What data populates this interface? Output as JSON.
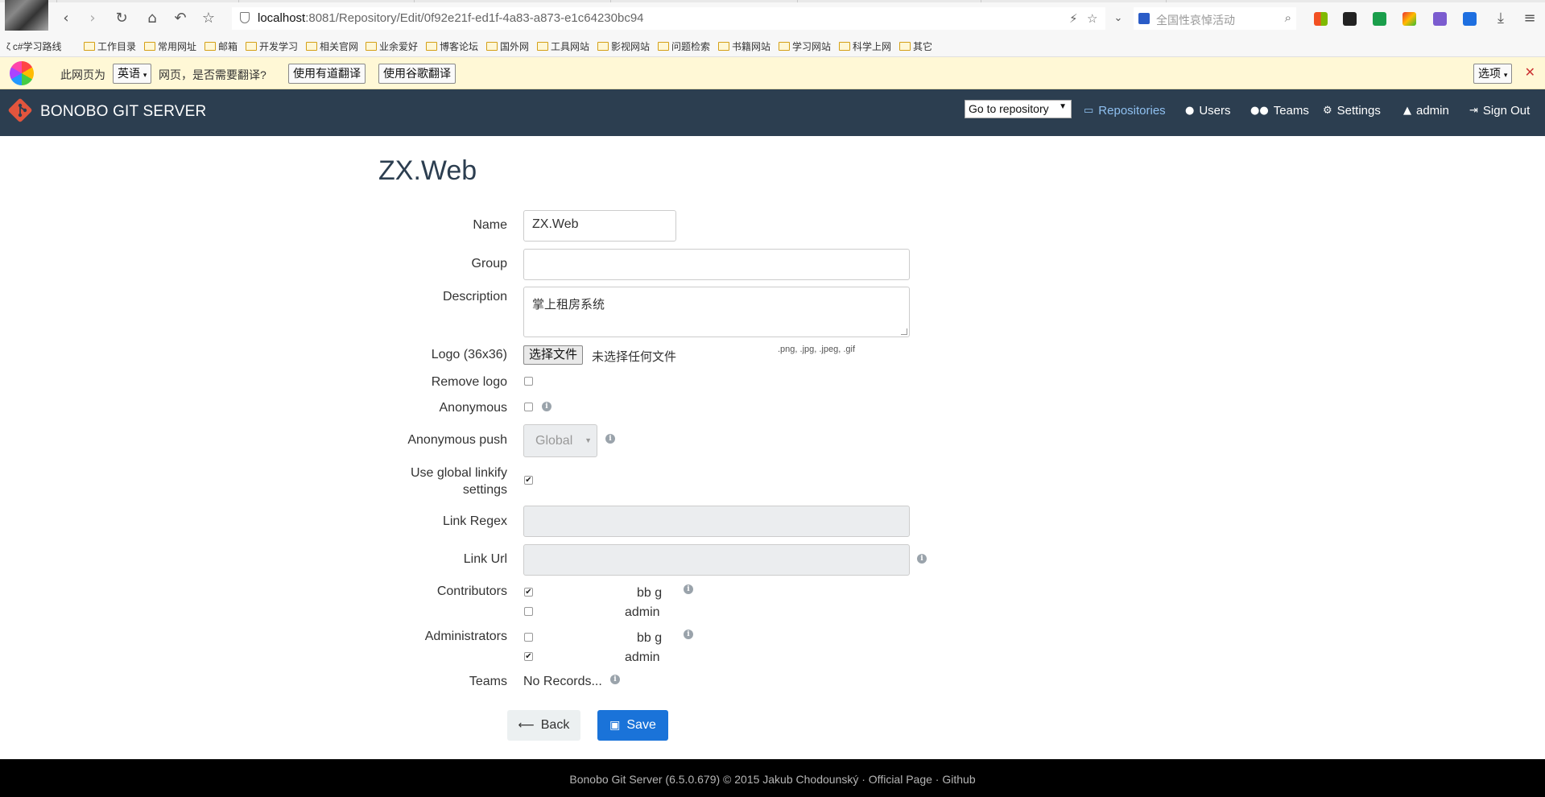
{
  "browser": {
    "url_host": "localhost",
    "url_path": ":8081/Repository/Edit/0f92e21f-ed1f-4a83-a873-e1c64230bc94",
    "search_placeholder": "全国性哀悼活动",
    "bookmarks": [
      "c#学习路线",
      "工作目录",
      "常用网址",
      "邮箱",
      "开发学习",
      "相关官网",
      "业余爱好",
      "博客论坛",
      "国外网",
      "工具网站",
      "影视网站",
      "问题检索",
      "书籍网站",
      "学习网站",
      "科学上网",
      "其它"
    ]
  },
  "translate_bar": {
    "prefix": "此网页为",
    "language": "英语",
    "suffix": "网页，是否需要翻译?",
    "youdao_button": "使用有道翻译",
    "google_button": "使用谷歌翻译",
    "options_button": "选项"
  },
  "navbar": {
    "brand": "BONOBO GIT SERVER",
    "goto_repository": "Go to repository",
    "items": [
      "Repositories",
      "Users",
      "Teams",
      "Settings",
      "admin",
      "Sign Out"
    ]
  },
  "form": {
    "title": "ZX.Web",
    "labels": {
      "name": "Name",
      "group": "Group",
      "description": "Description",
      "logo": "Logo (36x36)",
      "remove_logo": "Remove logo",
      "anonymous": "Anonymous",
      "anonymous_push": "Anonymous push",
      "use_global_linkify_line1": "Use global linkify",
      "use_global_linkify_line2": "settings",
      "link_regex": "Link Regex",
      "link_url": "Link Url",
      "contributors": "Contributors",
      "administrators": "Administrators",
      "teams": "Teams"
    },
    "values": {
      "name": "ZX.Web",
      "group": "",
      "description": "掌上租房系统",
      "anonymous_push": "Global",
      "link_regex": "",
      "link_url": ""
    },
    "file": {
      "button": "选择文件",
      "status": "未选择任何文件",
      "hint": ".png, .jpg, .jpeg, .gif"
    },
    "checks": {
      "remove_logo": false,
      "anonymous": false,
      "use_global_linkify": true
    },
    "contributors": [
      {
        "name": "bb g",
        "checked": true
      },
      {
        "name": "admin",
        "checked": false
      }
    ],
    "administrators": [
      {
        "name": "bb g",
        "checked": false
      },
      {
        "name": "admin",
        "checked": true
      }
    ],
    "teams_empty": "No Records...",
    "back_button": "Back",
    "save_button": "Save"
  },
  "footer": {
    "text": "Bonobo Git Server (6.5.0.679) © 2015 Jakub Chodounský · ",
    "official_link": "Official Page",
    "sep": " · ",
    "github_link": "Github"
  },
  "colors": {
    "navbar": "#2c3e50",
    "active_nav": "#8fc0f0",
    "primary": "#1a73d9",
    "footer": "#000000"
  }
}
